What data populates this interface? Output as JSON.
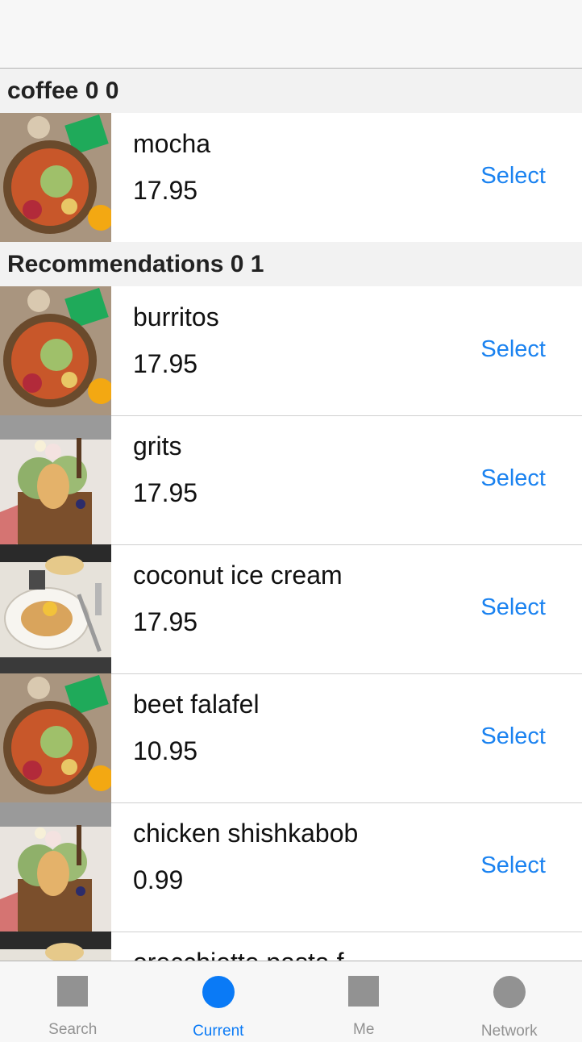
{
  "sections": [
    {
      "title": "coffee 0 0",
      "items": [
        {
          "name": "mocha",
          "price": "17.95",
          "select_label": "Select",
          "thumb": "bowl"
        }
      ]
    },
    {
      "title": "Recommendations 0 1",
      "items": [
        {
          "name": "burritos",
          "price": "17.95",
          "select_label": "Select",
          "thumb": "bowl"
        },
        {
          "name": "grits",
          "price": "17.95",
          "select_label": "Select",
          "thumb": "icecream"
        },
        {
          "name": "coconut ice cream",
          "price": "17.95",
          "select_label": "Select",
          "thumb": "pancake"
        },
        {
          "name": "beet falafel",
          "price": "10.95",
          "select_label": "Select",
          "thumb": "bowl"
        },
        {
          "name": "chicken shishkabob",
          "price": "0.99",
          "select_label": "Select",
          "thumb": "icecream"
        },
        {
          "name": "orecchiette pasta f",
          "price": "",
          "select_label": "",
          "thumb": "pancake"
        }
      ]
    }
  ],
  "tabbar": {
    "tabs": [
      {
        "label": "Search",
        "icon": "square-icon",
        "active": false
      },
      {
        "label": "Current",
        "icon": "circle-icon",
        "active": true
      },
      {
        "label": "Me",
        "icon": "square-icon",
        "active": false
      },
      {
        "label": "Network",
        "icon": "circle-icon",
        "active": false
      }
    ]
  },
  "colors": {
    "accent": "#0a7af6",
    "select_text": "#1a82f0",
    "inactive_tab": "#929292",
    "section_bg": "#f2f2f2"
  }
}
